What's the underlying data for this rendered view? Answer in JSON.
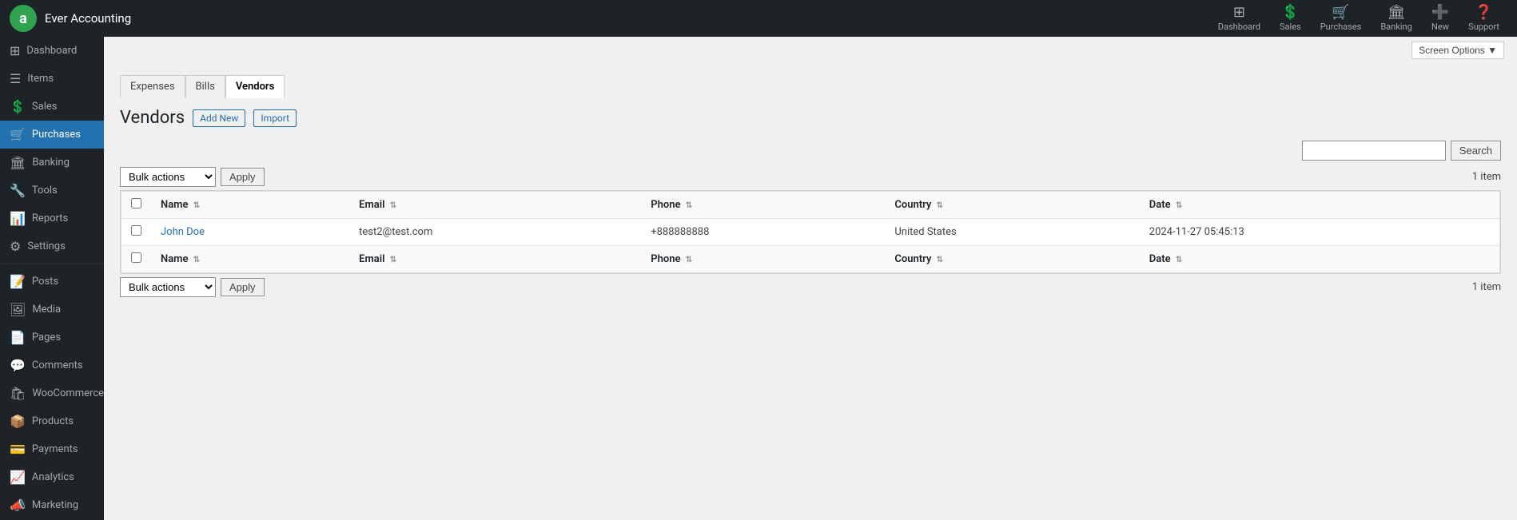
{
  "app": {
    "title": "Ever Accounting",
    "logo_letter": "a"
  },
  "topnav": {
    "items": [
      {
        "id": "dashboard",
        "label": "Dashboard",
        "icon": "⊞"
      },
      {
        "id": "sales",
        "label": "Sales",
        "icon": "$"
      },
      {
        "id": "purchases",
        "label": "Purchases",
        "icon": "🛒"
      },
      {
        "id": "banking",
        "label": "Banking",
        "icon": "🏦"
      },
      {
        "id": "new",
        "label": "New",
        "icon": "+"
      },
      {
        "id": "support",
        "label": "Support",
        "icon": "?"
      }
    ]
  },
  "screen_options": {
    "label": "Screen Options ▼"
  },
  "sidebar": {
    "items": [
      {
        "id": "dashboard",
        "label": "Dashboard",
        "icon": "⊞",
        "active": false
      },
      {
        "id": "items",
        "label": "Items",
        "icon": "☰",
        "active": false
      },
      {
        "id": "sales",
        "label": "Sales",
        "icon": "$",
        "active": false
      },
      {
        "id": "purchases",
        "label": "Purchases",
        "icon": "🛒",
        "active": true
      },
      {
        "id": "banking",
        "label": "Banking",
        "icon": "🏦",
        "active": false
      },
      {
        "id": "tools",
        "label": "Tools",
        "icon": "🔧",
        "active": false
      },
      {
        "id": "reports",
        "label": "Reports",
        "icon": "📊",
        "active": false
      },
      {
        "id": "settings",
        "label": "Settings",
        "icon": "⚙",
        "active": false
      }
    ],
    "wp_items": [
      {
        "id": "posts",
        "label": "Posts",
        "icon": "📝"
      },
      {
        "id": "media",
        "label": "Media",
        "icon": "🖼"
      },
      {
        "id": "pages",
        "label": "Pages",
        "icon": "📄"
      },
      {
        "id": "comments",
        "label": "Comments",
        "icon": "💬"
      },
      {
        "id": "woocommerce",
        "label": "WooCommerce",
        "icon": "🛍"
      },
      {
        "id": "products",
        "label": "Products",
        "icon": "📦"
      },
      {
        "id": "payments",
        "label": "Payments",
        "icon": "💳"
      },
      {
        "id": "analytics",
        "label": "Analytics",
        "icon": "📈"
      },
      {
        "id": "marketing",
        "label": "Marketing",
        "icon": "📣"
      }
    ]
  },
  "tabs": [
    {
      "id": "expenses",
      "label": "Expenses",
      "active": false
    },
    {
      "id": "bills",
      "label": "Bills",
      "active": false
    },
    {
      "id": "vendors",
      "label": "Vendors",
      "active": true
    }
  ],
  "page": {
    "title": "Vendors",
    "add_new_label": "Add New",
    "import_label": "Import"
  },
  "search": {
    "placeholder": "",
    "button_label": "Search"
  },
  "bulk_top": {
    "label": "Bulk actions",
    "apply_label": "Apply",
    "item_count": "1 item"
  },
  "bulk_bottom": {
    "label": "Bulk actions",
    "apply_label": "Apply",
    "item_count": "1 item"
  },
  "table": {
    "columns": [
      {
        "id": "name",
        "label": "Name"
      },
      {
        "id": "email",
        "label": "Email"
      },
      {
        "id": "phone",
        "label": "Phone"
      },
      {
        "id": "country",
        "label": "Country"
      },
      {
        "id": "date",
        "label": "Date"
      }
    ],
    "rows": [
      {
        "name": "John Doe",
        "email": "test2@test.com",
        "phone": "+888888888",
        "country": "United States",
        "date": "2024-11-27 05:45:13"
      }
    ]
  }
}
